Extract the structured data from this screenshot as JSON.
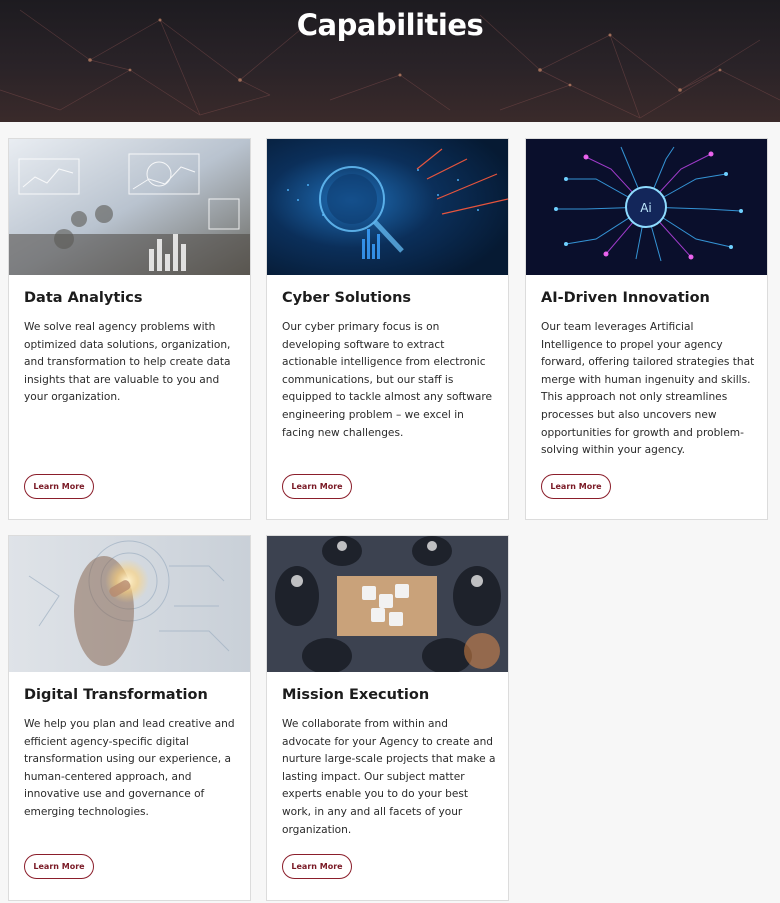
{
  "hero": {
    "title": "Capabilities"
  },
  "cards": [
    {
      "title": "Data Analytics",
      "text": "We solve real agency problems with optimized data solutions, organization, and transformation to help create data insights that are valuable to you and your organization.",
      "button": "Learn More",
      "image_icon": "data-dashboard-image"
    },
    {
      "title": "Cyber Solutions",
      "text": "Our cyber primary focus is on developing software to extract actionable intelligence from electronic communications, but our staff is equipped to tackle almost any software engineering problem – we excel in facing new challenges.",
      "button": "Learn More",
      "image_icon": "cyber-lens-image"
    },
    {
      "title": "AI-Driven Innovation",
      "text": "Our team leverages Artificial Intelligence to propel your agency forward, offering tailored strategies that merge with human ingenuity and skills. This approach not only streamlines processes but also uncovers new opportunities for growth and problem-solving within your agency.",
      "button": "Learn More",
      "image_icon": "ai-chip-image",
      "chip_label": "Ai"
    },
    {
      "title": "Digital Transformation",
      "text": "We help you plan and lead creative and efficient agency-specific digital transformation using our experience, a human-centered approach, and innovative use and governance of emerging technologies.",
      "button": "Learn More",
      "image_icon": "digital-touch-image"
    },
    {
      "title": "Mission Execution",
      "text": "We collaborate from within and advocate for your Agency to create and nurture large-scale projects that make a lasting impact. Our subject matter experts enable you to do your best work, in any and all facets of your organization.",
      "button": "Learn More",
      "image_icon": "team-puzzle-image"
    }
  ],
  "colors": {
    "accent": "#8b1e2b",
    "page_bg": "#f7f7f7",
    "hero_bg": "#1d1b20"
  }
}
